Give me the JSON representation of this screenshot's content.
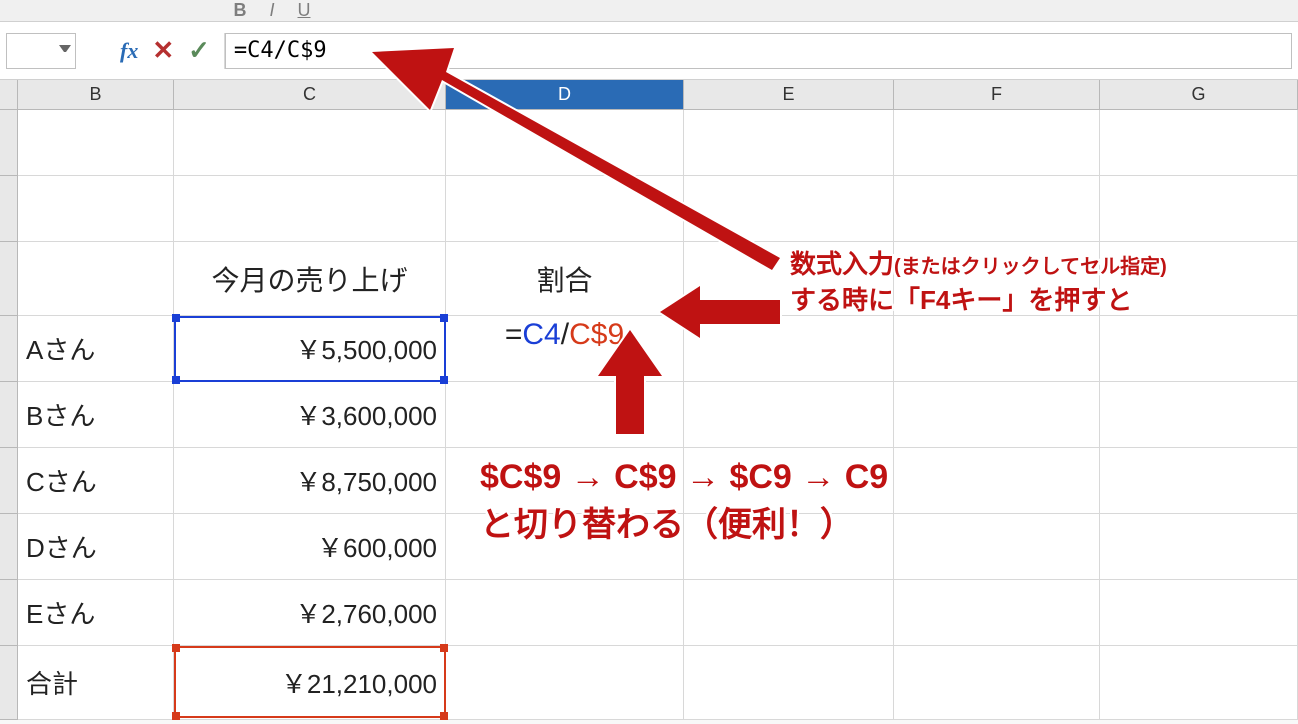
{
  "toolbar": {
    "bold_icon": "B",
    "italic_icon": "I",
    "underline_icon": "U"
  },
  "formula_bar": {
    "name_box": "",
    "fx_label": "fx",
    "cancel_glyph": "✕",
    "accept_glyph": "✓",
    "formula_text": "=C4/C$9"
  },
  "columns": [
    "B",
    "C",
    "D",
    "E",
    "F",
    "G"
  ],
  "active_column": "D",
  "data": {
    "header_c": "今月の売り上げ",
    "header_d": "割合",
    "rows": [
      {
        "label": "Aさん",
        "value": "￥5,500,000"
      },
      {
        "label": "Bさん",
        "value": "￥3,600,000"
      },
      {
        "label": "Cさん",
        "value": "￥8,750,000"
      },
      {
        "label": "Dさん",
        "value": "￥600,000"
      },
      {
        "label": "Eさん",
        "value": "￥2,760,000"
      },
      {
        "label": "合計",
        "value": "￥21,210,000"
      }
    ]
  },
  "editing_cell": {
    "eq": "=",
    "ref1": "C4",
    "slash": "/",
    "ref2": "C$9"
  },
  "annotations": {
    "top_line1_a": "数式入力",
    "top_line1_b": "(またはクリックしてセル指定)",
    "top_line2": "する時に「F4キー」を押すと",
    "mid": "$C$9 → C$9 → $C9 → C9\nと切り替わる（便利！）"
  }
}
